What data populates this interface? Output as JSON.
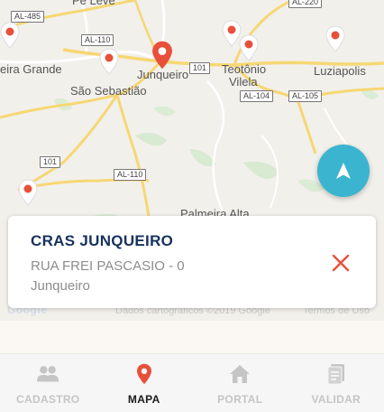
{
  "map": {
    "towns": [
      {
        "id": "palmeira-grande",
        "label": "eira Grande"
      },
      {
        "id": "sao-sebastiao",
        "label": "São Sebastião"
      },
      {
        "id": "junqueiro",
        "label": "Junqueiro"
      },
      {
        "id": "teotonio-vilela-1",
        "label": "Teotônio"
      },
      {
        "id": "teotonio-vilela-2",
        "label": "Vilela"
      },
      {
        "id": "luziapolis",
        "label": "Luziapolis"
      },
      {
        "id": "pe-leve",
        "label": "Pé Leve"
      },
      {
        "id": "palmeira-alta",
        "label": "Palmeira Alta"
      }
    ],
    "shields": [
      "AL-485",
      "AL-110",
      "101",
      "AL-104",
      "AL-105",
      "101",
      "AL-110",
      "AL-220"
    ],
    "attribution": "Dados cartográficos ©2019 Google",
    "terms": "Termos de Uso",
    "logo": "Google",
    "marker_color": "#e8503a",
    "selected_marker_color": "#e8503a",
    "accent_color": "#3bb4cf"
  },
  "locate_button": {
    "icon": "navigation-arrow-icon"
  },
  "card": {
    "title": "CRAS JUNQUEIRO",
    "address": "RUA FREI PASCASIO - 0",
    "city": "Junqueiro",
    "close_icon": "close-icon"
  },
  "tabs": [
    {
      "id": "cadastro",
      "label": "CADASTRO",
      "icon": "users-icon",
      "active": false
    },
    {
      "id": "mapa",
      "label": "MAPA",
      "icon": "map-pin-icon",
      "active": true
    },
    {
      "id": "portal",
      "label": "PORTAL",
      "icon": "home-icon",
      "active": false
    },
    {
      "id": "validar",
      "label": "VALIDAR",
      "icon": "document-icon",
      "active": false
    }
  ]
}
